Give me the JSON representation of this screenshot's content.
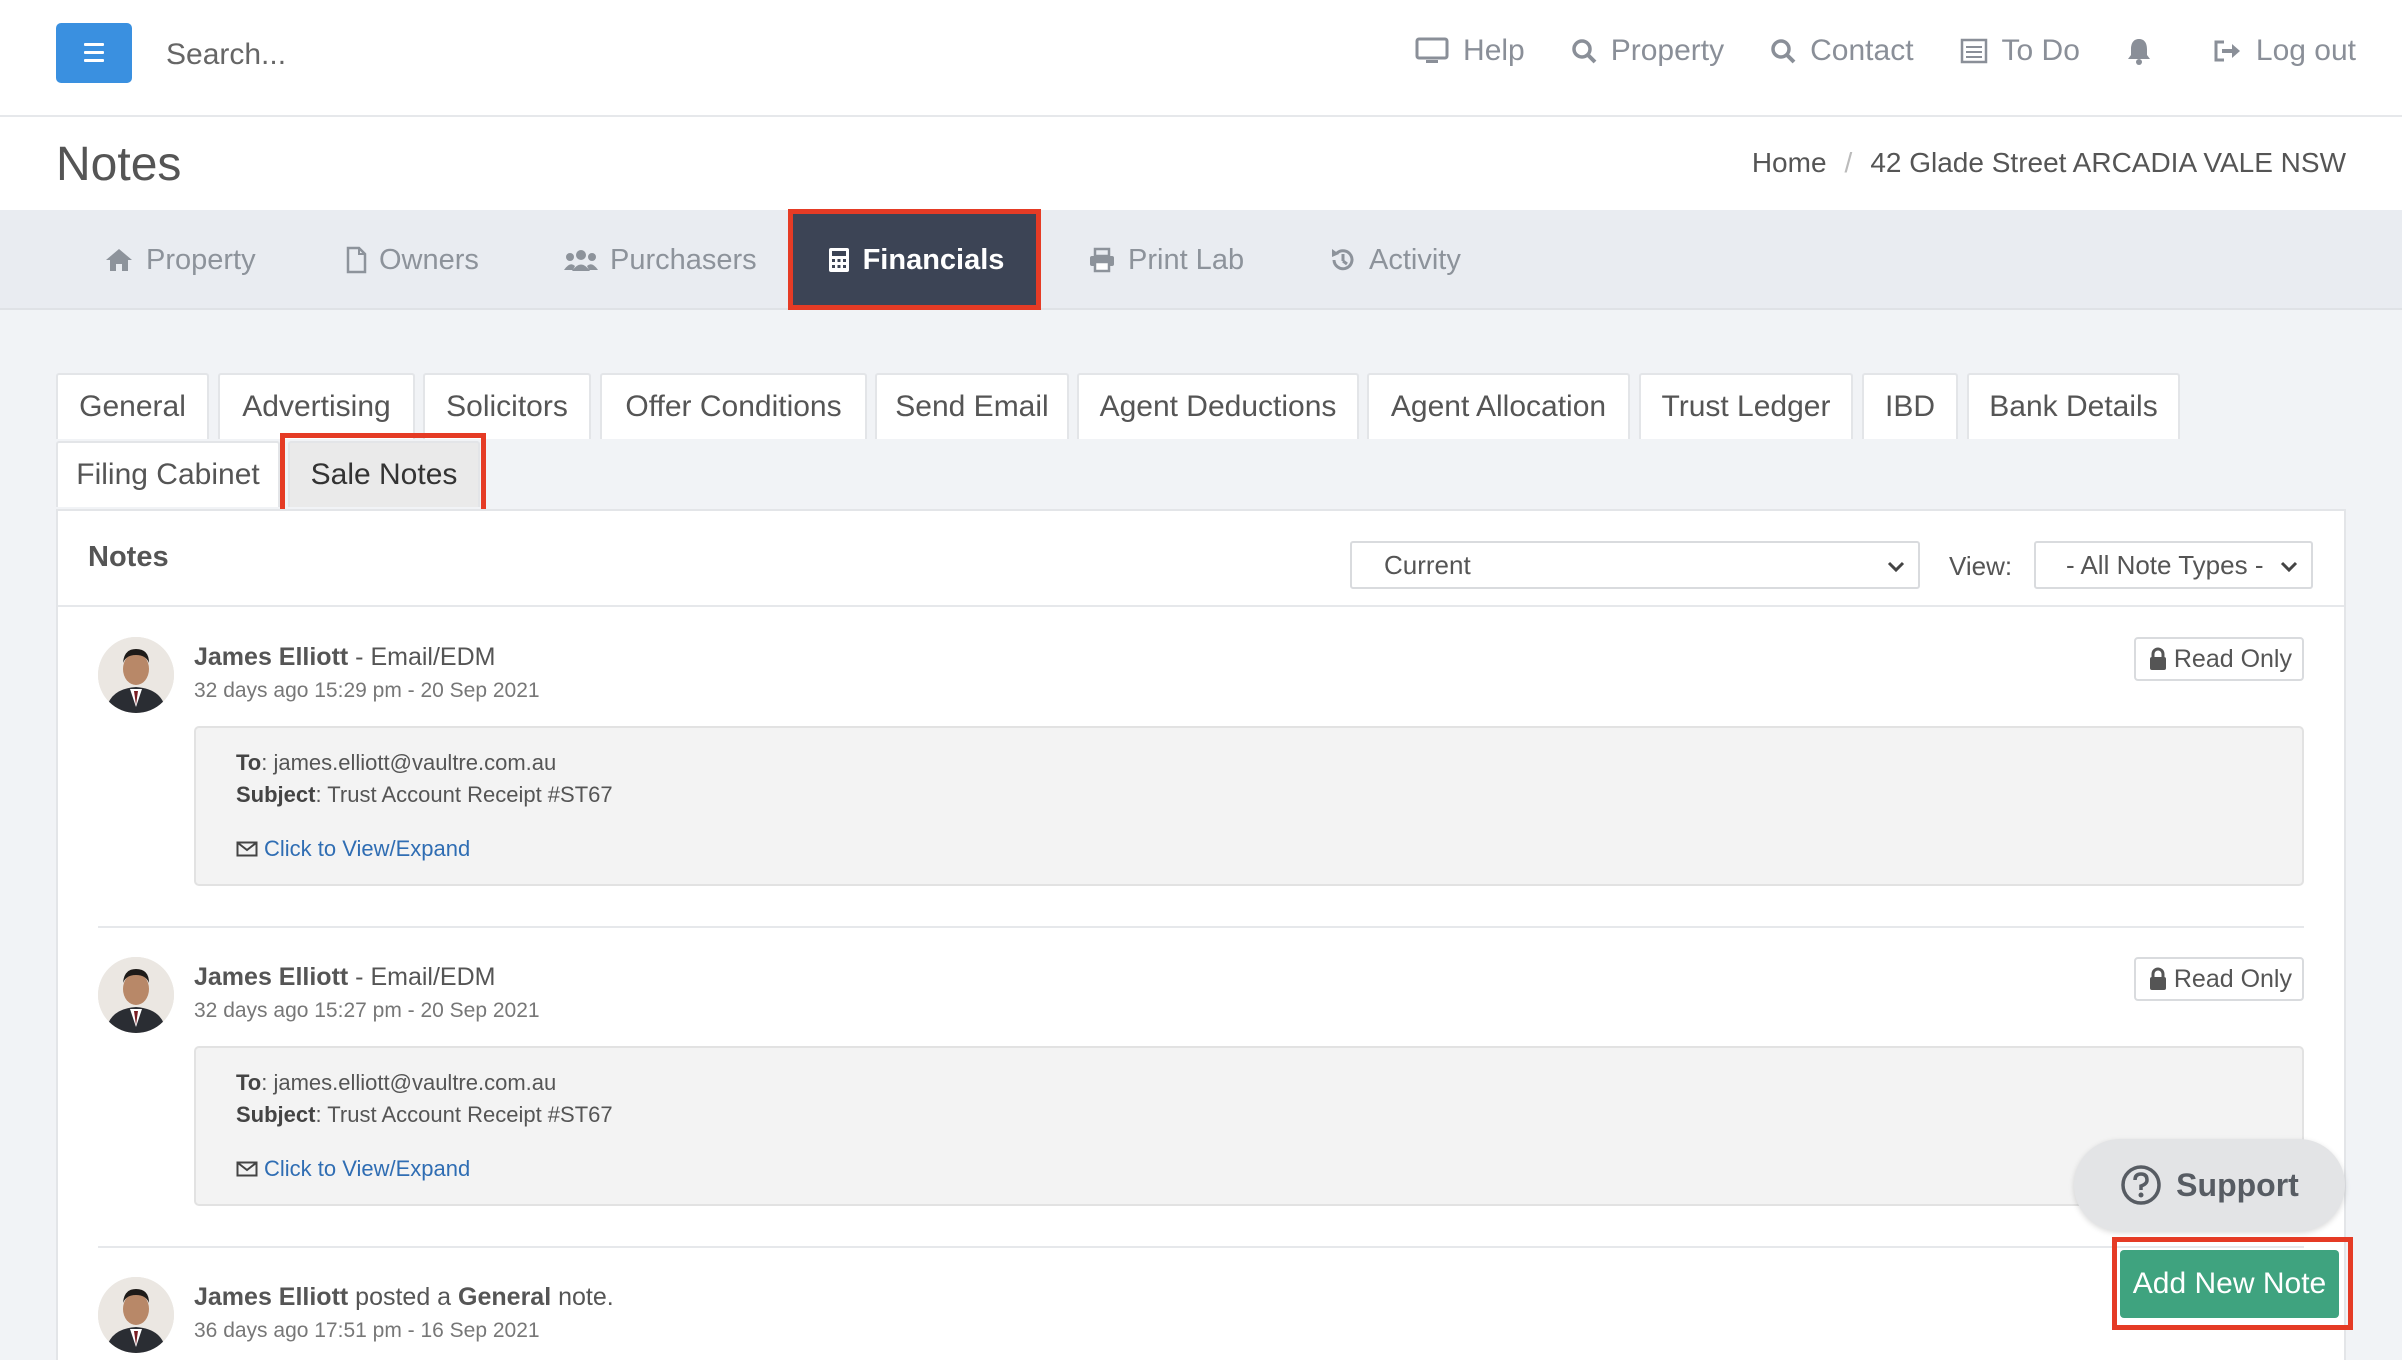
{
  "topbar": {
    "search_placeholder": "Search...",
    "nav": {
      "help": "Help",
      "property": "Property",
      "contact": "Contact",
      "todo": "To Do",
      "logout": "Log out"
    }
  },
  "page": {
    "title": "Notes",
    "breadcrumb": {
      "home": "Home",
      "current": "42 Glade Street ARCADIA VALE NSW"
    }
  },
  "main_tabs": {
    "property": "Property",
    "owners": "Owners",
    "purchasers": "Purchasers",
    "financials": "Financials",
    "print_lab": "Print Lab",
    "activity": "Activity",
    "active": "Financials"
  },
  "sub_tabs": {
    "general": "General",
    "advertising": "Advertising",
    "solicitors": "Solicitors",
    "offer_conditions": "Offer Conditions",
    "send_email": "Send Email",
    "agent_deductions": "Agent Deductions",
    "agent_allocation": "Agent Allocation",
    "trust_ledger": "Trust Ledger",
    "ibd": "IBD",
    "bank_details": "Bank Details",
    "filing_cabinet": "Filing Cabinet",
    "sale_notes": "Sale Notes",
    "active": "Sale Notes"
  },
  "panel": {
    "title": "Notes",
    "status_select": "Current",
    "view_label": "View:",
    "view_select": "- All Note Types -"
  },
  "notes": [
    {
      "author": "James Elliott",
      "type_suffix": " - Email/EDM",
      "time": "32 days ago 15:29 pm - 20 Sep 2021",
      "badge": "Read Only",
      "to_label": "To",
      "to": ": james.elliott@vaultre.com.au",
      "subject_label": "Subject",
      "subject": ": Trust Account Receipt #ST67",
      "expand": "Click to View/Expand"
    },
    {
      "author": "James Elliott",
      "type_suffix": " - Email/EDM",
      "time": "32 days ago 15:27 pm - 20 Sep 2021",
      "badge": "Read Only",
      "to_label": "To",
      "to": ": james.elliott@vaultre.com.au",
      "subject_label": "Subject",
      "subject": ": Trust Account Receipt #ST67",
      "expand": "Click to View/Expand"
    },
    {
      "author": "James Elliott",
      "posted": " posted a ",
      "note_type": "General",
      "suffix": " note.",
      "time": "36 days ago 17:51 pm - 16 Sep 2021"
    }
  ],
  "floating": {
    "support": "Support",
    "add_note": "Add New Note"
  },
  "colors": {
    "menu_button": "#3a90e0",
    "active_tab": "#3c4455",
    "highlight": "#e53b25",
    "add_button": "#3fa37f",
    "link": "#2f6db3"
  }
}
